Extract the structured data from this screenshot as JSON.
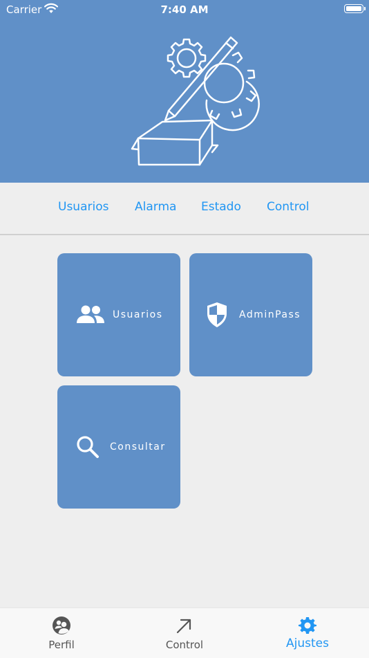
{
  "status_bar": {
    "carrier": "Carrier",
    "time": "7:40 AM"
  },
  "header": {
    "logo_icon": "gear-pen-box-icon"
  },
  "top_tabs": [
    {
      "label": "Usuarios"
    },
    {
      "label": "Alarma"
    },
    {
      "label": "Estado"
    },
    {
      "label": "Control"
    }
  ],
  "tiles": [
    {
      "label": "Usuarios",
      "icon": "users-icon"
    },
    {
      "label": "AdminPass",
      "icon": "shield-icon"
    },
    {
      "label": "Consultar",
      "icon": "search-icon"
    }
  ],
  "bottom_nav": [
    {
      "label": "Perfil",
      "icon": "profile-icon"
    },
    {
      "label": "Control",
      "icon": "arrow-up-right-icon"
    },
    {
      "label": "Ajustes",
      "icon": "gear-icon",
      "active": true
    }
  ],
  "colors": {
    "brand": "#6090c8",
    "accent": "#2196f3",
    "background": "#eeeeee"
  }
}
